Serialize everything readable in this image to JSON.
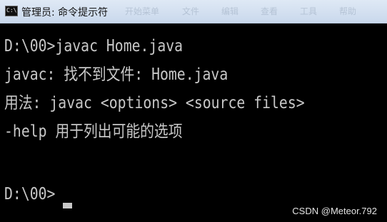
{
  "window": {
    "title": "管理员: 命令提示符",
    "icon_text": "C:\\",
    "background_tabs": [
      "开始菜单",
      "文件",
      "编辑",
      "查看",
      "工具",
      "帮助"
    ]
  },
  "console": {
    "lines": [
      "D:\\00>javac Home.java",
      "javac: 找不到文件: Home.java",
      "用法: javac <options> <source files>",
      "-help 用于列出可能的选项",
      "",
      "D:\\00>"
    ]
  },
  "watermark": "CSDN @Meteor.792",
  "colors": {
    "console_bg": "#000000",
    "console_text": "#c8c8c8",
    "titlebar": "#d4e1f1"
  }
}
